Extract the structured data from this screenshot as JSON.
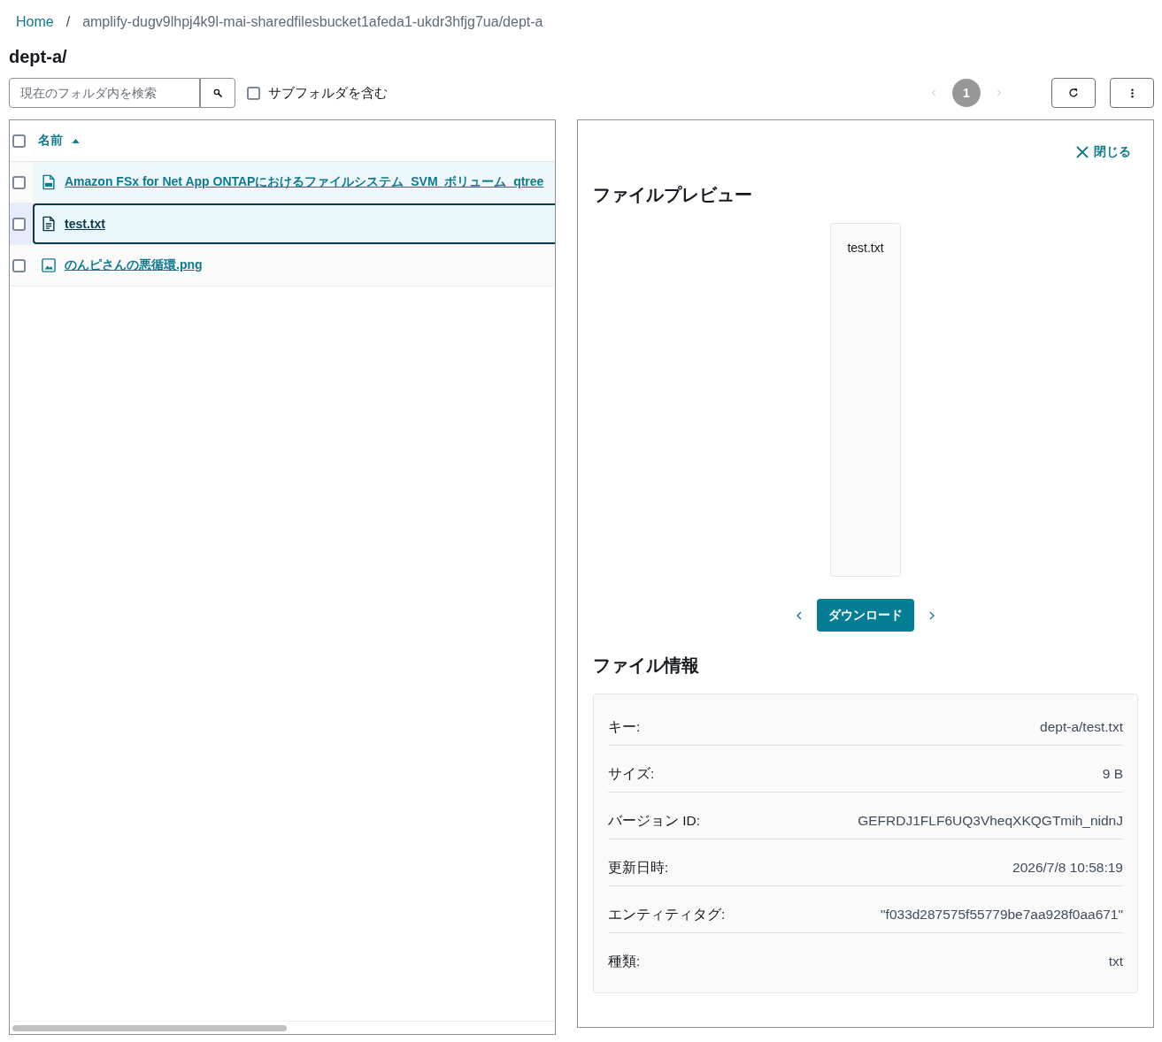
{
  "breadcrumb": {
    "items": [
      {
        "label": "Home",
        "kind": "link"
      },
      {
        "label": "amplify-dugv9lhpj4k9l-mai-sharedfilesbucket1afeda1-ukdr3hfjg7ua/dept-a",
        "kind": "current"
      }
    ],
    "separator": "/"
  },
  "title": "dept-a/",
  "toolbar": {
    "search": {
      "placeholder": "現在のフォルダ内を検索"
    },
    "include_subfolders": {
      "label": "サブフォルダを含む",
      "checked": false
    },
    "pagination": {
      "previous": {
        "disabled": true
      },
      "next": {
        "disabled": true
      },
      "pages": [
        {
          "label": "1",
          "selected": true
        }
      ]
    }
  },
  "file_table": {
    "select_all_checked": false,
    "columns": [
      {
        "label": "名前",
        "sorted": true,
        "descending": false
      }
    ],
    "rows": [
      {
        "name": "Amazon FSx for Net App ONTAPにおけるファイルシステム_SVM_ボリューム_qtree",
        "kind": "pdf",
        "checked": false,
        "selected": false,
        "hovered": true
      },
      {
        "name": "test.txt",
        "kind": "text",
        "checked": false,
        "selected": true,
        "hovered": false
      },
      {
        "name": "のんピさんの悪循環.png",
        "kind": "image",
        "checked": false,
        "selected": false,
        "hovered": false
      }
    ]
  },
  "preview": {
    "close_label": "閉じる",
    "heading": "ファイルプレビュー",
    "file_name": "test.txt",
    "download_label": "ダウンロード"
  },
  "file_info": {
    "heading": "ファイル情報",
    "rows": [
      {
        "label": "キー:",
        "value": "dept-a/test.txt"
      },
      {
        "label": "サイズ:",
        "value": "9 B"
      },
      {
        "label": "バージョン ID:",
        "value": "GEFRDJ1FLF6UQ3VheqXKQGTmih_nidnJ"
      },
      {
        "label": "更新日時:",
        "value": "2026/7/8 10:58:19"
      },
      {
        "label": "エンティティタグ:",
        "value": "\"f033d287575f55779be7aa928f0aa671\""
      },
      {
        "label": "種類:",
        "value": "txt"
      }
    ]
  }
}
